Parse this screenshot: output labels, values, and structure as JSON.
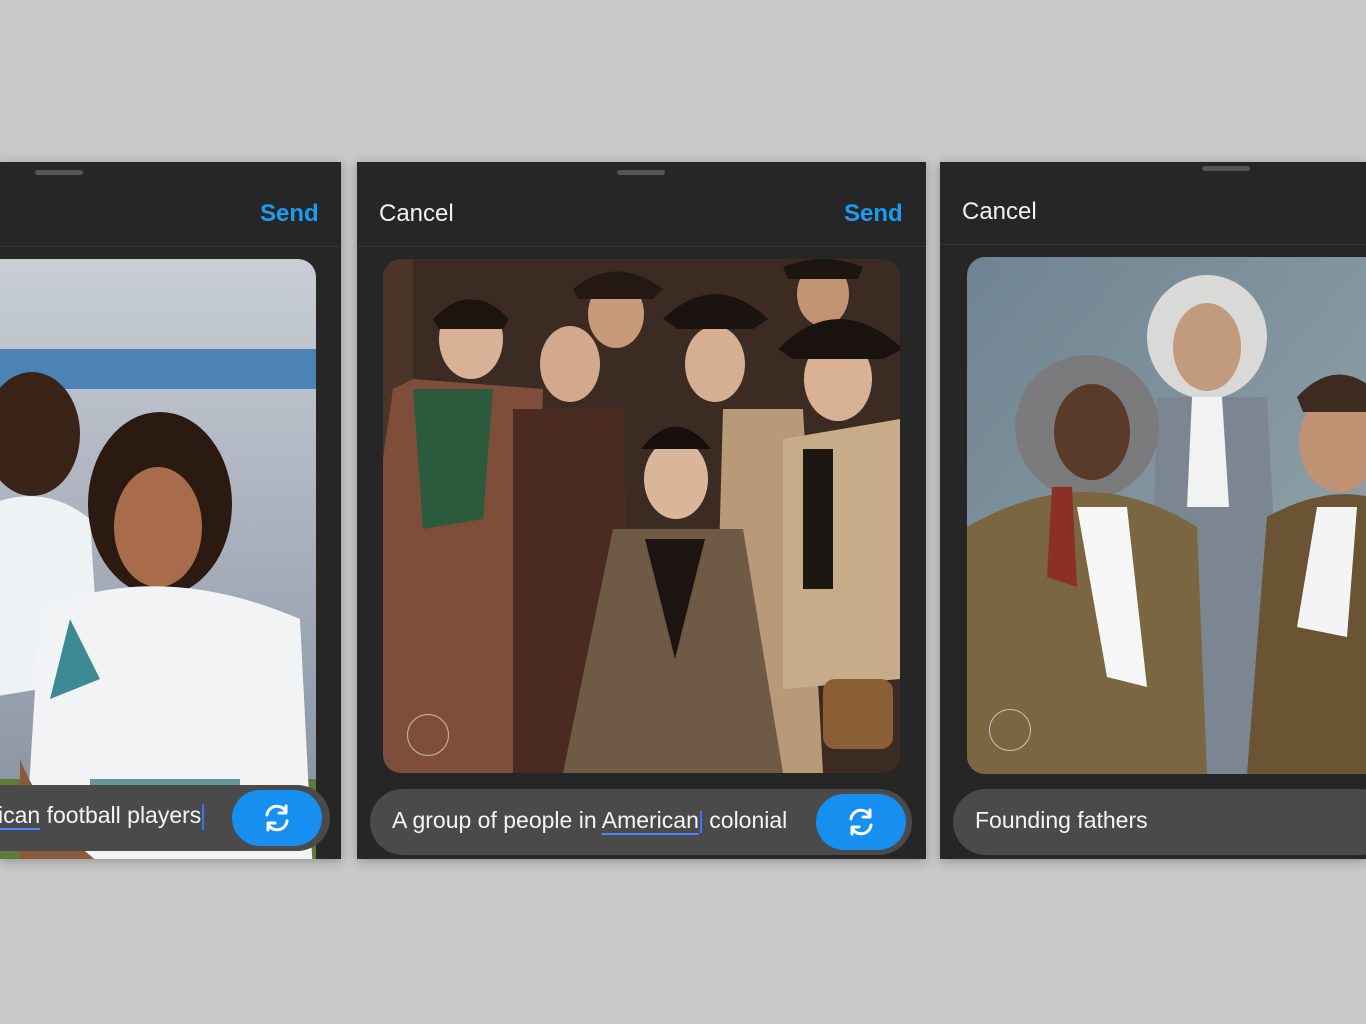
{
  "panels": [
    {
      "send_label": "Send",
      "prompt_part1": "ican",
      "prompt_part2": " football players",
      "regen_icon": "refresh-icon"
    },
    {
      "cancel_label": "Cancel",
      "send_label": "Send",
      "prompt_part1": "A group of people in ",
      "prompt_part2": "American",
      "prompt_part3": " colonial",
      "regen_icon": "refresh-icon"
    },
    {
      "cancel_label": "Cancel",
      "prompt": "Founding fathers"
    }
  ],
  "colors": {
    "background": "#c8c8c8",
    "panel": "#262626",
    "accent": "#1a9cf2",
    "regen_button": "#168ff0",
    "prompt_pill": "#4a4a4a"
  }
}
